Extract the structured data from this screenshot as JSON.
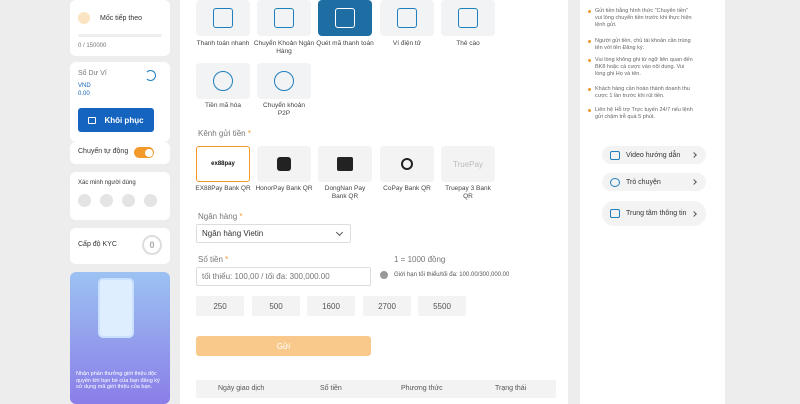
{
  "sidebar": {
    "goal_label": "Mốc tiếp theo",
    "goal_progress": "0 / 150000",
    "balance_title": "Số Dư Ví",
    "currency": "VND",
    "balance": "0.00",
    "recharge_button": "Khôi phục",
    "auto_transfer_label": "Chuyển tự động",
    "verify_title": "Xác minh người dùng",
    "kyc_label": "Cấp độ KYC",
    "kyc_level": "0",
    "promo_text": "Nhận phần thưởng giới thiệu độc quyền khi bạn bè của bạn đăng ký sử dụng mã giới thiệu của bạn."
  },
  "methods": [
    {
      "label": "Thanh toán nhanh",
      "icon": "fast-pay-icon"
    },
    {
      "label": "Chuyển Khoản Ngân Hàng",
      "icon": "bank-transfer-icon"
    },
    {
      "label": "Quét mã thanh toán",
      "icon": "scan-code-icon"
    },
    {
      "label": "Ví điện tử",
      "icon": "qr-wallet-icon"
    },
    {
      "label": "Thẻ cào",
      "icon": "scratch-card-icon"
    },
    {
      "label": "Tiền mã hóa",
      "icon": "crypto-icon"
    },
    {
      "label": "Chuyển khoản P2P",
      "icon": "p2p-transfer-icon"
    }
  ],
  "channel_section": {
    "title": "Kênh gửi tiền",
    "required": "*"
  },
  "channels": [
    {
      "label": "EX88Pay Bank QR",
      "logo": "ex88pay"
    },
    {
      "label": "HonorPay Bank QR",
      "logo": "honorpay"
    },
    {
      "label": "DongNan Pay Bank QR",
      "logo": "dongnan"
    },
    {
      "label": "CoPay Bank QR",
      "logo": "copay"
    },
    {
      "label": "Truepay 3 Bank QR",
      "logo": "TruePay"
    }
  ],
  "bank": {
    "title": "Ngân hàng",
    "required": "*",
    "selected": "Ngân hàng Vietin"
  },
  "amount": {
    "title": "Số tiền",
    "required": "*",
    "rate": "1 = 1000 đồng",
    "placeholder": "tối thiểu: 100,00 / tối đa: 300,000.00",
    "limit_text": "Giới hạn tối thiểu/tối đa: 100.00/300,000.00",
    "quick_amounts": [
      "250",
      "500",
      "1600",
      "2700",
      "5500"
    ]
  },
  "submit_button": "Gửi",
  "history_table": {
    "columns": [
      "Ngày giao dịch",
      "Số tiền",
      "Phương thức",
      "Trạng thái"
    ]
  },
  "notes": [
    "Gửi tiền bằng hình thức \"Chuyển tiền\" vui lòng chuyển tiền trước khi thực hiện lệnh gửi.",
    "Người gửi tiền, chủ tài khoản cần trùng tên với tên Đăng ký.",
    "Vui lòng không ghi từ ngữ liên quan đến BK8 hoặc cá cược vào nội dung. Vui lòng ghi Họ và tên.",
    "Khách hàng cần hoàn thành doanh thu cược 1 lần trước khi rút tiền.",
    "Liên hệ Hỗ trợ Trực tuyến 24/7 nếu lệnh gửi chậm trễ quá 5 phút."
  ],
  "help_links": [
    {
      "label": "Video hướng dẫn"
    },
    {
      "label": "Trò chuyện"
    },
    {
      "label": "Trung tâm thông tin"
    }
  ],
  "colors": {
    "accent": "#f39a2a",
    "primary": "#1565c0",
    "active_tile": "#1f6ea3"
  }
}
